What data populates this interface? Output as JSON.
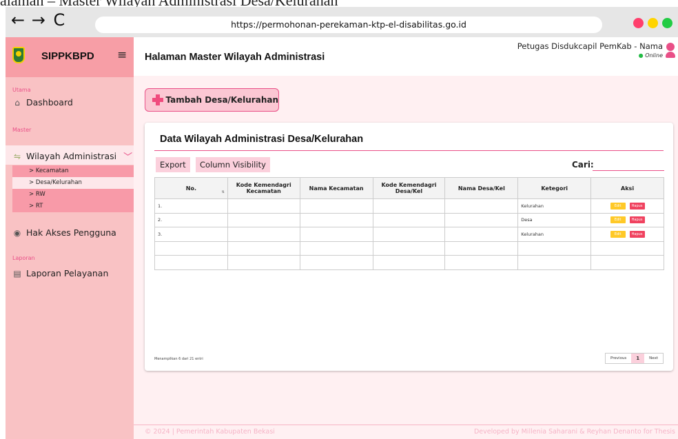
{
  "page_caption": "alaman – Master Wilayah Administrasi Desa/Kelurahan",
  "browser": {
    "back": "←",
    "forward": "→",
    "reload": "C",
    "url": "https://permohonan-perekaman-ktp-el-disabilitas.go.id",
    "dot_colors": [
      "#ff3f6c",
      "#ffd400",
      "#22cc44"
    ]
  },
  "sidebar": {
    "brand": "SIPPKBPD",
    "hamburger": "≡",
    "section_utama": "Utama",
    "dashboard": "Dashboard",
    "section_master": "Master",
    "wilayah": "Wilayah Administrasi",
    "sub_items": [
      "> Kecamatan",
      "> Desa/Kelurahan",
      "> RW",
      "> RT"
    ],
    "hak_akses": "Hak Akses Pengguna",
    "section_laporan": "Laporan",
    "laporan": "Laporan Pelayanan"
  },
  "header": {
    "title": "Halaman Master Wilayah Administrasi",
    "user": "Petugas Disdukcapil PemKab - Nama",
    "status": "Online"
  },
  "main": {
    "add_button": "Tambah Desa/Kelurahan",
    "card_title": "Data Wilayah Administrasi Desa/Kelurahan",
    "export": "Export",
    "column_visibility": "Column Visibility",
    "search_label": "Cari:",
    "columns": [
      "No.",
      "Kode Kemendagri Kecamatan",
      "Nama Kecamatan",
      "Kode Kemendagri Desa/Kel",
      "Nama Desa/Kel",
      "Ketegori",
      "Aksi"
    ],
    "rows": [
      {
        "no": "1.",
        "kategori": "Kelurahan",
        "edit": "Edit",
        "hapus": "Hapus"
      },
      {
        "no": "2.",
        "kategori": "Desa",
        "edit": "Edit",
        "hapus": "Hapus"
      },
      {
        "no": "3.",
        "kategori": "Kelurahan",
        "edit": "Edit",
        "hapus": "Hapus"
      }
    ],
    "info": "Menampilkan 6 dari 21 entri",
    "pager": {
      "previous": "Previous",
      "page": "1",
      "next": "Next"
    }
  },
  "footer": {
    "left": "© 2024 | Pemerintah Kabupaten Bekasi",
    "right": "Developed by Millenia Saharani & Reyhan Denanto for Thesis"
  },
  "colors": {
    "accent": "#e94f87",
    "sidebar_bg": "#f9c2c4",
    "brand_bg": "#f79ea6",
    "edit": "#ffc928",
    "delete": "#f0425f"
  }
}
